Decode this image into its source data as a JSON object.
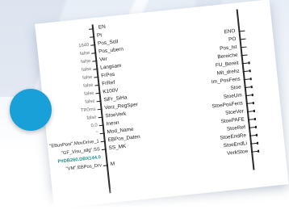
{
  "block": {
    "en_label": "EN",
    "inputs": [
      {
        "value": "",
        "name": "Pt"
      },
      {
        "value": "1640",
        "name": "Pos_Soll"
      },
      {
        "value": "false",
        "name": "Pos_ubern"
      },
      {
        "value": "false",
        "name": "Ver"
      },
      {
        "value": "false",
        "name": "Langsam"
      },
      {
        "value": "false",
        "name": "FrPos"
      },
      {
        "value": "false",
        "name": "FrRef"
      },
      {
        "value": "false",
        "name": "K100V"
      },
      {
        "value": "false",
        "name": "SiFr_SiHa"
      },
      {
        "value": "TR0ms",
        "name": "Verz_RegSper"
      },
      {
        "value": "false",
        "name": "StoeVerk"
      },
      {
        "value": "0.0",
        "name": "Inenn"
      },
      {
        "value": "''",
        "name": "Mod_Name"
      },
      {
        "value": "\"EBusPosi\".MovDrive_1",
        "name": "EBPos_Daten"
      },
      {
        "value": "\"GF_Visu_allg\".SS",
        "name": "SS_MK"
      },
      {
        "value": "P#DB260.DBX144.0",
        "name": "",
        "style": "teal"
      },
      {
        "value": "\"VM\".EBPos_Drv",
        "name": "M",
        "style": "dark"
      }
    ],
    "outputs": [
      {
        "name": "ENO"
      },
      {
        "name": "PO"
      },
      {
        "name": "Pos_Ist"
      },
      {
        "name": "Bereiche"
      },
      {
        "name": "FU_Bereit"
      },
      {
        "name": "Mit_drehz"
      },
      {
        "name": "Im_PosFens"
      },
      {
        "name": "Stoe"
      },
      {
        "name": "StoeUm"
      },
      {
        "name": "StoePosFens"
      },
      {
        "name": "StoeVer"
      },
      {
        "name": "StoePAFE"
      },
      {
        "name": "StoeRef"
      },
      {
        "name": "StoeEndRe"
      },
      {
        "name": "StoeEndLi"
      },
      {
        "name": "VerkStoe"
      }
    ]
  },
  "colors": {
    "accent_circle": "#1aa0d8",
    "teal_value": "#1e8f8a"
  }
}
